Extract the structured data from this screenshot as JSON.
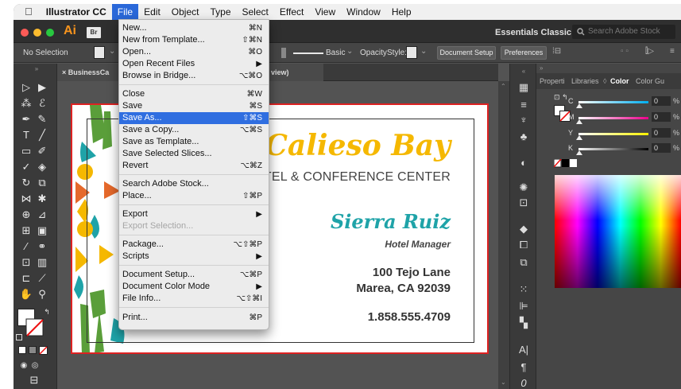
{
  "menubar": {
    "items": [
      "Illustrator CC",
      "File",
      "Edit",
      "Object",
      "Type",
      "Select",
      "Effect",
      "View",
      "Window",
      "Help"
    ]
  },
  "appbar": {
    "app_abbrev": "Ai",
    "bridge_badge": "Br",
    "workspace": "Essentials Classic",
    "search_placeholder": "Search Adobe Stock"
  },
  "control": {
    "selection": "No Selection",
    "stroke_style": "Basic",
    "opacity_label": "Opacity",
    "style_label": "Style:",
    "document_setup": "Document Setup",
    "preferences": "Preferences"
  },
  "tab": {
    "title": "BusinessCa"
  },
  "tab_suffix": "view)",
  "card": {
    "company": "Calieso Bay",
    "subtitle": "HOTEL & CONFERENCE CENTER",
    "name": "Sierra Ruiz",
    "role": "Hotel Manager",
    "address1": "100 Tejo Lane",
    "address2": "Marea, CA 92039",
    "phone": "1.858.555.4709",
    "accent": "#f5b800",
    "teal": "#1fa3a8"
  },
  "panel": {
    "tabs": [
      "Properti",
      "Libraries",
      "Color",
      "Color Gu"
    ],
    "channels": [
      {
        "label": "C",
        "value": "0",
        "unit": "%"
      },
      {
        "label": "M",
        "value": "0",
        "unit": "%"
      },
      {
        "label": "Y",
        "value": "0",
        "unit": "%"
      },
      {
        "label": "K",
        "value": "0",
        "unit": "%"
      }
    ]
  },
  "file_menu": {
    "items": [
      {
        "label": "New...",
        "shortcut": "⌘N"
      },
      {
        "label": "New from Template...",
        "shortcut": "⇧⌘N"
      },
      {
        "label": "Open...",
        "shortcut": "⌘O"
      },
      {
        "label": "Open Recent Files",
        "shortcut": "▶"
      },
      {
        "label": "Browse in Bridge...",
        "shortcut": "⌥⌘O"
      },
      {
        "label": "Close",
        "shortcut": "⌘W"
      },
      {
        "label": "Save",
        "shortcut": "⌘S"
      },
      {
        "label": "Save As...",
        "shortcut": "⇧⌘S"
      },
      {
        "label": "Save a Copy...",
        "shortcut": "⌥⌘S"
      },
      {
        "label": "Save as Template...",
        "shortcut": ""
      },
      {
        "label": "Save Selected Slices...",
        "shortcut": ""
      },
      {
        "label": "Revert",
        "shortcut": "⌥⌘Z"
      },
      {
        "label": "Search Adobe Stock...",
        "shortcut": ""
      },
      {
        "label": "Place...",
        "shortcut": "⇧⌘P"
      },
      {
        "label": "Export",
        "shortcut": "▶"
      },
      {
        "label": "Export Selection...",
        "shortcut": ""
      },
      {
        "label": "Package...",
        "shortcut": "⌥⇧⌘P"
      },
      {
        "label": "Scripts",
        "shortcut": "▶"
      },
      {
        "label": "Document Setup...",
        "shortcut": "⌥⌘P"
      },
      {
        "label": "Document Color Mode",
        "shortcut": "▶"
      },
      {
        "label": "File Info...",
        "shortcut": "⌥⇧⌘I"
      },
      {
        "label": "Print...",
        "shortcut": "⌘P"
      }
    ]
  }
}
